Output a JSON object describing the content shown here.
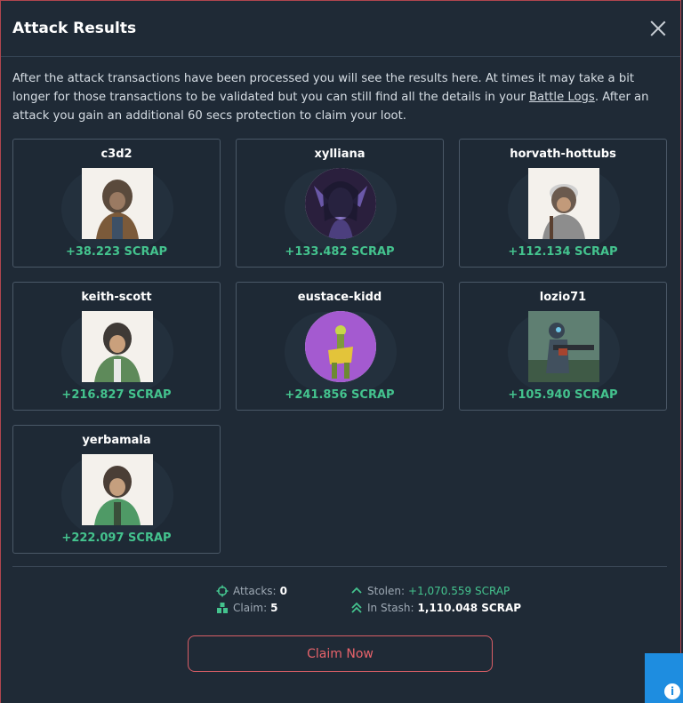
{
  "modal": {
    "title": "Attack Results",
    "description_pre": "After the attack transactions have been processed you will see the results here. At times it may take a bit longer for those transactions to be validated but you can still find all the details in your ",
    "description_link": "Battle Logs",
    "description_post": ". After an attack you gain an additional 60 secs protection to claim your loot."
  },
  "results": [
    {
      "name": "c3d2",
      "gain": "+38.223 SCRAP",
      "avatar": "ape"
    },
    {
      "name": "xylliana",
      "gain": "+133.482 SCRAP",
      "avatar": "elf"
    },
    {
      "name": "horvath-hottubs",
      "gain": "+112.134 SCRAP",
      "avatar": "ape-gray"
    },
    {
      "name": "keith-scott",
      "gain": "+216.827 SCRAP",
      "avatar": "ape-green"
    },
    {
      "name": "eustace-kidd",
      "gain": "+241.856 SCRAP",
      "avatar": "purple-creature"
    },
    {
      "name": "lozio71",
      "gain": "+105.940 SCRAP",
      "avatar": "soldier"
    },
    {
      "name": "yerbamala",
      "gain": "+222.097 SCRAP",
      "avatar": "ape-green"
    }
  ],
  "summary": {
    "attacks_label": "Attacks:",
    "attacks_value": "0",
    "claim_label": "Claim:",
    "claim_value": "5",
    "stolen_label": "Stolen:",
    "stolen_value": "+1,070.559 SCRAP",
    "stash_label": "In Stash:",
    "stash_value": "1,110.048 SCRAP"
  },
  "claim_button": "Claim Now",
  "help_button": "i",
  "colors": {
    "accent": "#44c38e",
    "danger": "#e8636b",
    "help": "#1e8de0"
  }
}
